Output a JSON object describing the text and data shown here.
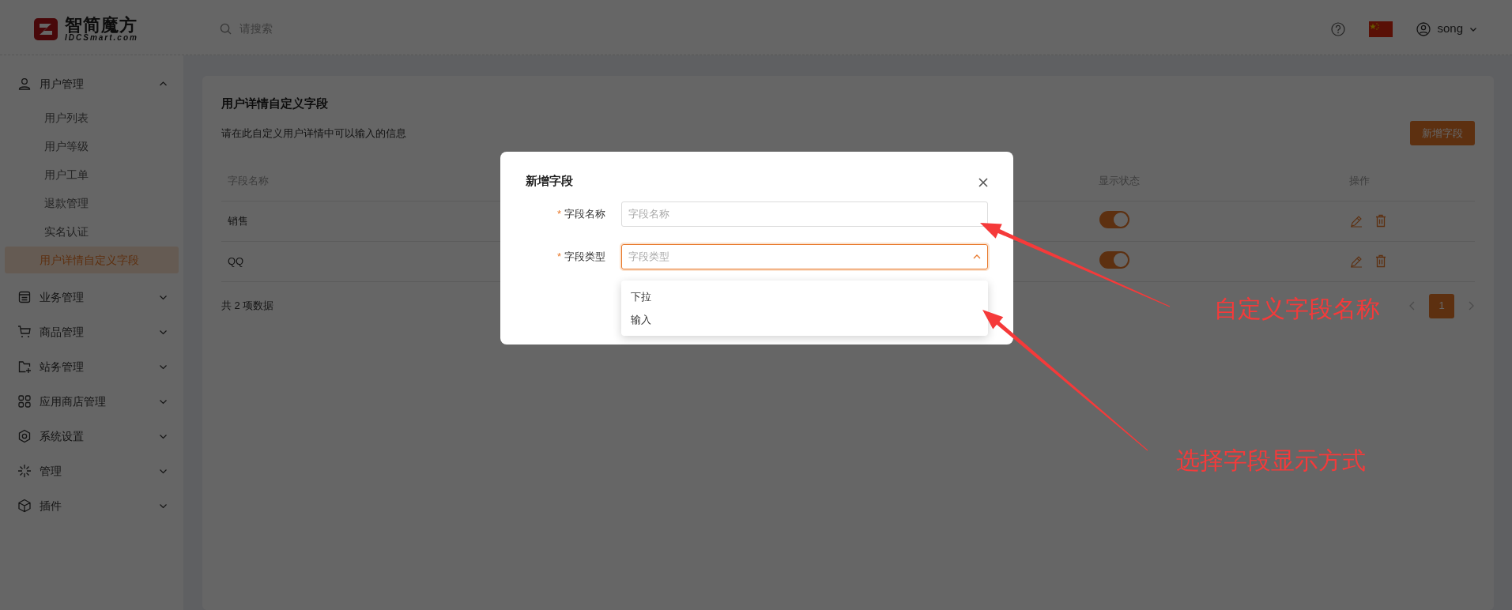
{
  "logo": {
    "name": "智简魔方",
    "domain": "IDCSmart.com"
  },
  "header": {
    "search": {
      "placeholder": "请搜索"
    },
    "user": "song"
  },
  "sidebar": {
    "items": [
      {
        "label": "用户管理",
        "expanded": true,
        "children": [
          {
            "label": "用户列表",
            "selected": false
          },
          {
            "label": "用户等级",
            "selected": false
          },
          {
            "label": "用户工单",
            "selected": false
          },
          {
            "label": "退款管理",
            "selected": false
          },
          {
            "label": "实名认证",
            "selected": false
          },
          {
            "label": "用户详情自定义字段",
            "selected": true
          }
        ]
      },
      {
        "label": "业务管理",
        "expanded": false
      },
      {
        "label": "商品管理",
        "expanded": false
      },
      {
        "label": "站务管理",
        "expanded": false
      },
      {
        "label": "应用商店管理",
        "expanded": false
      },
      {
        "label": "系统设置",
        "expanded": false
      },
      {
        "label": "管理",
        "expanded": false
      },
      {
        "label": "插件",
        "expanded": false
      }
    ]
  },
  "page": {
    "title": "用户详情自定义字段",
    "description": "请在此自定义用户详情中可以输入的信息",
    "add_button": "新增字段",
    "table": {
      "columns": [
        "字段名称",
        "显示状态",
        "操作"
      ],
      "rows": [
        {
          "name": "销售",
          "on": true
        },
        {
          "name": "QQ",
          "on": true
        }
      ]
    },
    "total": "共 2 项数据",
    "pages": [
      {
        "label": "1",
        "selected": true
      }
    ]
  },
  "dialog": {
    "title": "新增字段",
    "required_mark": "*",
    "fields": [
      {
        "kind": "input",
        "label": "字段名称",
        "required": true,
        "placeholder": "字段名称"
      },
      {
        "kind": "select",
        "label": "字段类型",
        "required": true,
        "placeholder": "字段类型",
        "expanded": true,
        "options": [
          "下拉",
          "输入"
        ]
      }
    ]
  },
  "annotations": [
    {
      "text": "自定义字段名称"
    },
    {
      "text": "选择字段显示方式"
    }
  ]
}
